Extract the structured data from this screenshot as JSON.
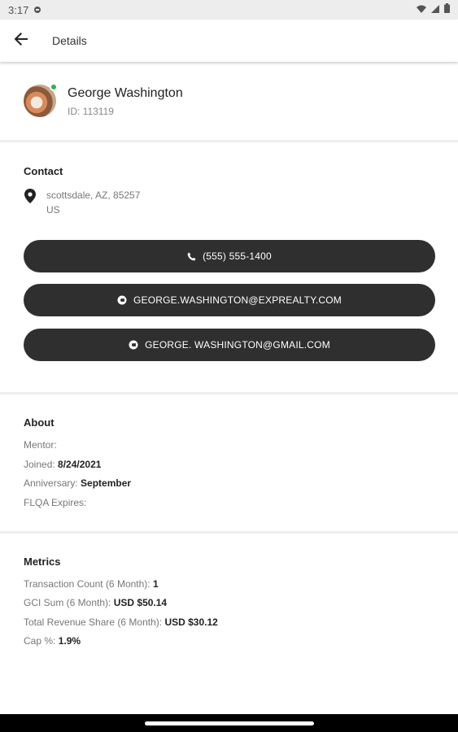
{
  "status_bar": {
    "time": "3:17"
  },
  "app_bar": {
    "title": "Details"
  },
  "profile": {
    "name": "George Washington",
    "id_text": "ID: 113119",
    "online_color": "#2fb344"
  },
  "contact": {
    "title": "Contact",
    "address_line1": "scottsdale, AZ, 85257",
    "address_line2": "US",
    "phone": "(555) 555-1400",
    "email_work": "GEORGE.WASHINGTON@EXPREALTY.COM",
    "email_personal": "GEORGE. WASHINGTON@GMAIL.COM"
  },
  "about": {
    "title": "About",
    "mentor_label": "Mentor:",
    "mentor_value": "",
    "joined_label": "Joined:",
    "joined_value": "8/24/2021",
    "anniversary_label": "Anniversary:",
    "anniversary_value": "September",
    "flqa_label": "FLQA Expires:",
    "flqa_value": ""
  },
  "metrics": {
    "title": "Metrics",
    "transaction_label": "Transaction Count (6 Month):",
    "transaction_value": "1",
    "gci_label": "GCI Sum (6 Month):",
    "gci_value": "USD $50.14",
    "revenue_label": "Total Revenue Share (6 Month):",
    "revenue_value": "USD $30.12",
    "cap_label": "Cap %:",
    "cap_value": "1.9%"
  },
  "icons": {
    "back": "arrow-left-icon",
    "location": "map-pin-icon",
    "phone": "phone-icon",
    "email": "at-sign-icon"
  }
}
